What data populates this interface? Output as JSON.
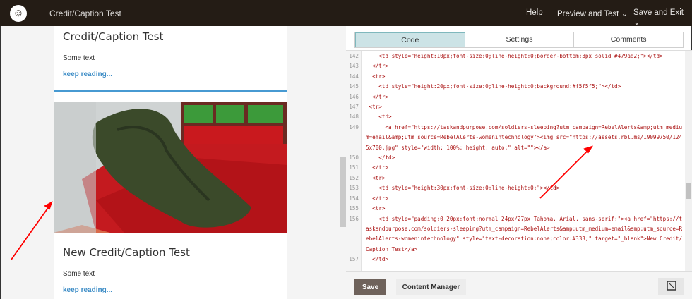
{
  "header": {
    "logo": "mailchimp-logo",
    "title": "Credit/Caption Test",
    "help": "Help",
    "preview": "Preview and Test",
    "save_exit": "Save and Exit"
  },
  "email": {
    "heading1": "Credit/Caption Test",
    "text1": "Some text",
    "link1": "keep reading...",
    "heading2": "New Credit/Caption Test",
    "text2": "Some text",
    "link2": "keep reading...",
    "divider_color": "#479ad2"
  },
  "editor": {
    "tabs": [
      {
        "label": "Code",
        "active": true
      },
      {
        "label": "Settings",
        "active": false
      },
      {
        "label": "Comments",
        "active": false
      }
    ],
    "lines": [
      {
        "n": "142",
        "code": "    <td style=\"height:10px;font-size:0;line-height:0;border-bottom:3px solid #479ad2;\"></td>"
      },
      {
        "n": "143",
        "code": "  </tr>"
      },
      {
        "n": "144",
        "code": "  <tr>"
      },
      {
        "n": "145",
        "code": "    <td style=\"height:20px;font-size:0;line-height:0;background:#f5f5f5;\"></td>"
      },
      {
        "n": "146",
        "code": "  </tr>"
      },
      {
        "n": "147",
        "code": " <tr>"
      },
      {
        "n": "148",
        "code": "    <td>"
      },
      {
        "n": "149",
        "code": "      <a href=\"https://taskandpurpose.com/soldiers-sleeping?utm_campaign=RebelAlerts&amp;utm_medium=email&amp;utm_source=RebelAlerts-womenintechnology\"><img src=\"https://assets.rbl.ms/19099750/1245x700.jpg\" style=\"width: 100%; height: auto;\" alt=\"\"></a>"
      },
      {
        "n": "150",
        "code": "    </td>"
      },
      {
        "n": "151",
        "code": "  </tr>"
      },
      {
        "n": "152",
        "code": "  <tr>"
      },
      {
        "n": "153",
        "code": "    <td style=\"height:30px;font-size:0;line-height:0;\"></td>"
      },
      {
        "n": "154",
        "code": "  </tr>"
      },
      {
        "n": "155",
        "code": "  <tr>"
      },
      {
        "n": "156",
        "code": "    <td style=\"padding:0 20px;font:normal 24px/27px Tahoma, Arial, sans-serif;\"><a href=\"https://taskandpurpose.com/soldiers-sleeping?utm_campaign=RebelAlerts&amp;utm_medium=email&amp;utm_source=RebelAlerts-womenintechnology\" style=\"text-decoration:none;color:#333;\" target=\"_blank\">New Credit/Caption Test</a>"
      },
      {
        "n": "157",
        "code": "  </td>"
      }
    ],
    "save": "Save",
    "content_manager": "Content Manager"
  },
  "annotation_color": "#ff0000"
}
